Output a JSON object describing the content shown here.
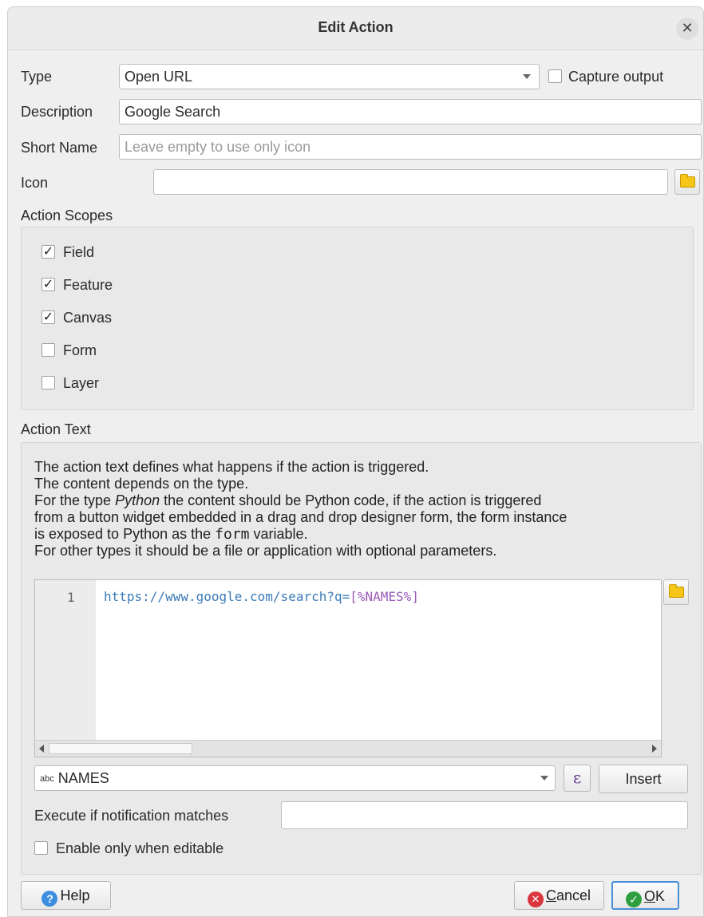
{
  "window": {
    "title": "Edit Action"
  },
  "form": {
    "type_label": "Type",
    "type_value": "Open URL",
    "capture_output_label": "Capture output",
    "capture_output_checked": false,
    "description_label": "Description",
    "description_value": "Google Search",
    "short_name_label": "Short Name",
    "short_name_placeholder": "Leave empty to use only icon",
    "icon_label": "Icon",
    "icon_value": ""
  },
  "scopes": {
    "title": "Action Scopes",
    "items": [
      {
        "label": "Field",
        "checked": true,
        "mark": "✓"
      },
      {
        "label": "Feature",
        "checked": true,
        "mark": "✓"
      },
      {
        "label": "Canvas",
        "checked": true,
        "mark": "✓"
      },
      {
        "label": "Form",
        "checked": false,
        "mark": ""
      },
      {
        "label": "Layer",
        "checked": false,
        "mark": ""
      }
    ]
  },
  "action_text": {
    "title": "Action Text",
    "help": {
      "line1": "The action text defines what happens if the action is triggered.",
      "line2": "The content depends on the type.",
      "line3_pre": "For the type ",
      "line3_em": "Python",
      "line3_post": " the content should be Python code, if the action is triggered",
      "line4": "from a button widget embedded in a drag and drop designer form, the form instance",
      "line5_pre": "is exposed to Python as the ",
      "line5_code": "form",
      "line5_post": " variable.",
      "line6": "For other types it should be a file or application with optional parameters."
    },
    "editor": {
      "line_number": "1",
      "code_prefix": "https://www.google.com/search?q=",
      "code_var": "[%NAMES%]"
    },
    "field_combo": {
      "type_badge": "abc",
      "value": "NAMES"
    },
    "expression_symbol": "ε",
    "insert_label": "Insert",
    "notification_label": "Execute if notification matches",
    "notification_value": "",
    "editable_label": "Enable only when editable",
    "editable_checked": false
  },
  "buttons": {
    "help": "Help",
    "cancel_underlined": "C",
    "cancel_rest": "ancel",
    "ok_underlined": "O",
    "ok_rest": "K"
  },
  "colors": {
    "help_icon": "#3d8fe0",
    "cancel_icon": "#d9363e",
    "ok_icon": "#2e9e3e",
    "ok_border": "#4a90d9"
  }
}
